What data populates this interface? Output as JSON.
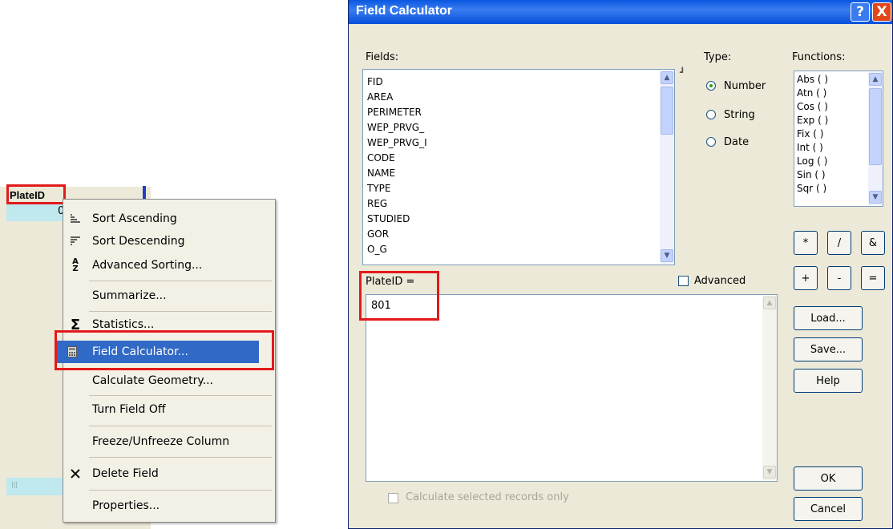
{
  "table": {
    "column_header": "PlateID",
    "first_cell_value": "0"
  },
  "context_menu": {
    "items": [
      {
        "label": "Sort Ascending",
        "icon": "sort-ascending-icon"
      },
      {
        "label": "Sort Descending",
        "icon": "sort-descending-icon"
      },
      {
        "label": "Advanced Sorting...",
        "icon": "az-sort-icon"
      },
      {
        "label": "Summarize...",
        "icon": ""
      },
      {
        "label": "Statistics...",
        "icon": "sigma-icon"
      },
      {
        "label": "Field Calculator...",
        "icon": "calculator-icon"
      },
      {
        "label": "Calculate Geometry...",
        "icon": ""
      },
      {
        "label": "Turn Field Off",
        "icon": ""
      },
      {
        "label": "Freeze/Unfreeze Column",
        "icon": ""
      },
      {
        "label": "Delete Field",
        "icon": "delete-x-icon"
      },
      {
        "label": "Properties...",
        "icon": ""
      }
    ],
    "highlighted": "Field Calculator..."
  },
  "dialog": {
    "title": "Field Calculator",
    "help_glyph": "?",
    "close_glyph": "X",
    "fields_label": "Fields:",
    "fields": [
      "FID",
      "AREA",
      "PERIMETER",
      "WEP_PRVG_",
      "WEP_PRVG_I",
      "CODE",
      "NAME",
      "TYPE",
      "REG",
      "STUDIED",
      "GOR",
      "O_G"
    ],
    "type_label": "Type:",
    "types": [
      {
        "label": "Number",
        "selected": true
      },
      {
        "label": "String",
        "selected": false
      },
      {
        "label": "Date",
        "selected": false
      }
    ],
    "functions_label": "Functions:",
    "functions": [
      "Abs ( )",
      "Atn ( )",
      "Cos ( )",
      "Exp ( )",
      "Fix ( )",
      "Int ( )",
      "Log ( )",
      "Sin ( )",
      "Sqr ( )"
    ],
    "operators": [
      "*",
      "/",
      "&",
      "+",
      "-",
      "="
    ],
    "expression_label": "PlateID =",
    "advanced_label": "Advanced",
    "expression_value": "801",
    "load_button": "Load...",
    "save_button": "Save...",
    "help_button": "Help",
    "ok_button": "OK",
    "cancel_button": "Cancel",
    "selected_only_label": "Calculate selected records only"
  },
  "colors": {
    "highlight": "#3169c6",
    "annotation_red": "#e3191b",
    "titlebar": "#0a58e0",
    "dialog_bg": "#ece9d8"
  }
}
